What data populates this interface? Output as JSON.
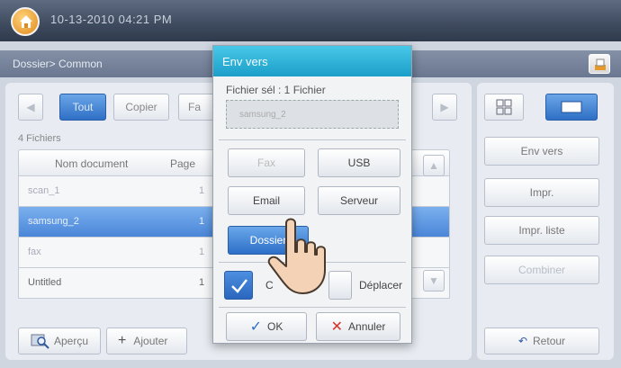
{
  "header": {
    "datetime": "10-13-2010 04:21 PM",
    "breadcrumb": "Dossier> Common"
  },
  "tabs": [
    {
      "label": "Tout",
      "active": true
    },
    {
      "label": "Copier",
      "active": false
    },
    {
      "label": "Fa",
      "active": false
    }
  ],
  "file_count": "4 Fichiers",
  "table": {
    "columns": [
      "Nom document",
      "Page"
    ],
    "rows": [
      {
        "name": "scan_1",
        "page": "1",
        "selected": false
      },
      {
        "name": "samsung_2",
        "page": "1",
        "selected": true
      },
      {
        "name": "fax",
        "page": "1",
        "selected": false
      },
      {
        "name": "Untitled",
        "page": "1",
        "selected": false
      }
    ]
  },
  "bottom": {
    "preview_label": "Aperçu",
    "add_label": "Ajouter"
  },
  "right_panel": {
    "send_label": "Env vers",
    "print_label": "Impr.",
    "print_list_label": "Impr. liste",
    "combine_label": "Combiner",
    "back_label": "Retour"
  },
  "dialog": {
    "title": "Env vers",
    "selected_text": "Fichier sél : 1 Fichier",
    "selected_file": "samsung_2",
    "fax_label": "Fax",
    "usb_label": "USB",
    "email_label": "Email",
    "server_label": "Serveur",
    "folder_label": "Dossier",
    "copy_label": "C",
    "move_label": "Déplacer",
    "ok_label": "OK",
    "cancel_label": "Annuler"
  },
  "colors": {
    "accent_blue": "#2f6fc5",
    "dialog_title": "#1b9ec9",
    "cancel_red": "#d9332b"
  }
}
